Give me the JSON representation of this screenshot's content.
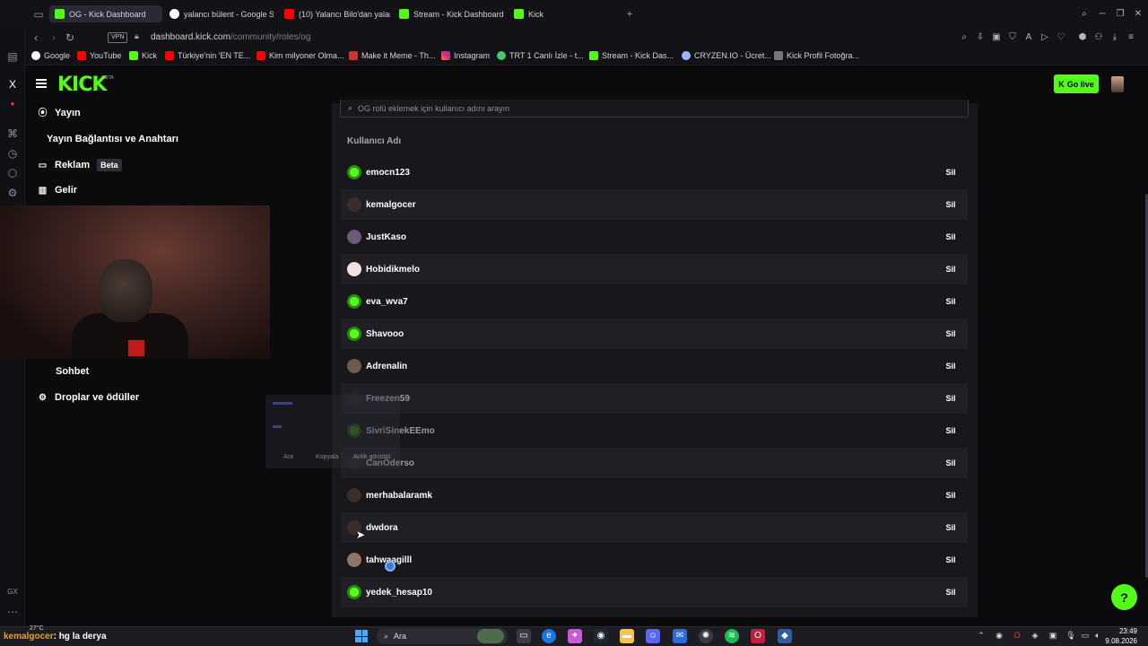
{
  "browser": {
    "tabs": [
      {
        "label": "OG - Kick Dashboard",
        "favicon": "kick-icon",
        "active": true
      },
      {
        "label": "yalancı bülent - Google Se",
        "favicon": "google-icon"
      },
      {
        "label": "(10) Yalancı Bilo'dan yalan",
        "favicon": "youtube-icon"
      },
      {
        "label": "Stream - Kick Dashboard",
        "favicon": "kick-icon"
      },
      {
        "label": "Kick",
        "favicon": "kick-icon"
      }
    ],
    "new_tab": "+",
    "vpn_label": "VPN",
    "url_domain": "dashboard.kick.com",
    "url_path": "/community/roles/og",
    "bookmarks": [
      {
        "label": "Google",
        "favicon": "google-icon"
      },
      {
        "label": "YouTube",
        "favicon": "youtube-icon"
      },
      {
        "label": "Kick",
        "favicon": "kick-icon"
      },
      {
        "label": "Türkiye'nin 'EN TE...",
        "favicon": "youtube-icon"
      },
      {
        "label": "Kim milyoner Olma...",
        "favicon": "youtube-icon"
      },
      {
        "label": "Make it Meme - Th...",
        "favicon": "meme-icon"
      },
      {
        "label": "Instagram",
        "favicon": "instagram-icon"
      },
      {
        "label": "TRT 1 Canlı İzle - t...",
        "favicon": "trt-icon"
      },
      {
        "label": "Stream - Kick Das...",
        "favicon": "kick-icon"
      },
      {
        "label": "CRYZEN.IO - Ücret...",
        "favicon": "cryzen-icon"
      },
      {
        "label": "Kick Profil Fotoğra...",
        "favicon": "page-icon"
      }
    ]
  },
  "header": {
    "logo": "KICK",
    "logo_badge": "BETA",
    "go_live": "Go live"
  },
  "sidebar": {
    "items": [
      {
        "label": "Yayın",
        "icon": "broadcast-icon"
      },
      {
        "label": "Yayın Bağlantısı ve Anahtarı",
        "icon": ""
      },
      {
        "label": "Reklam",
        "icon": "window-icon",
        "badge": "Beta"
      },
      {
        "label": "Gelir",
        "icon": "chart-icon"
      },
      {
        "label": "Sohbet",
        "icon": ""
      },
      {
        "label": "Droplar ve ödüller",
        "icon": "drops-icon"
      }
    ]
  },
  "main": {
    "search_placeholder": "OG rolü eklemek için kullanıcı adını arayın",
    "column_header": "Kullanıcı Adı",
    "delete_label": "Sil",
    "users": [
      {
        "name": "emocn123",
        "avatar": "green"
      },
      {
        "name": "kemalgocer",
        "avatar": "dark"
      },
      {
        "name": "JustKaso",
        "avatar": "purple"
      },
      {
        "name": "Hobidikmelo",
        "avatar": "white"
      },
      {
        "name": "eva_wva7",
        "avatar": "green"
      },
      {
        "name": "Shavooo",
        "avatar": "green"
      },
      {
        "name": "Adrenalin",
        "avatar": "brown"
      },
      {
        "name": "Freezen59",
        "avatar": "dark"
      },
      {
        "name": "SivriSinekEEmo",
        "avatar": "green"
      },
      {
        "name": "CanÖderso",
        "avatar": "dark"
      },
      {
        "name": "merhabalaramk",
        "avatar": "dark"
      },
      {
        "name": "dwdora",
        "avatar": "dark"
      },
      {
        "name": "tahwaagilll",
        "avatar": "tan"
      },
      {
        "name": "yedek_hesap10",
        "avatar": "green"
      }
    ]
  },
  "popup": {
    "items": [
      "Ara",
      "Kopyala",
      "Anlık görüntü"
    ]
  },
  "overlay": {
    "chat_user": "kemalgocer",
    "chat_message": ": hg la derya",
    "temperature": "27°C"
  },
  "taskbar": {
    "search_label": "Ara",
    "time": "23:49",
    "date": "9.08.2026"
  },
  "colors": {
    "kick_green": "#53fc18",
    "background": "#0b0b0e",
    "panel": "#17171c",
    "row_alt": "#1f1f25"
  }
}
